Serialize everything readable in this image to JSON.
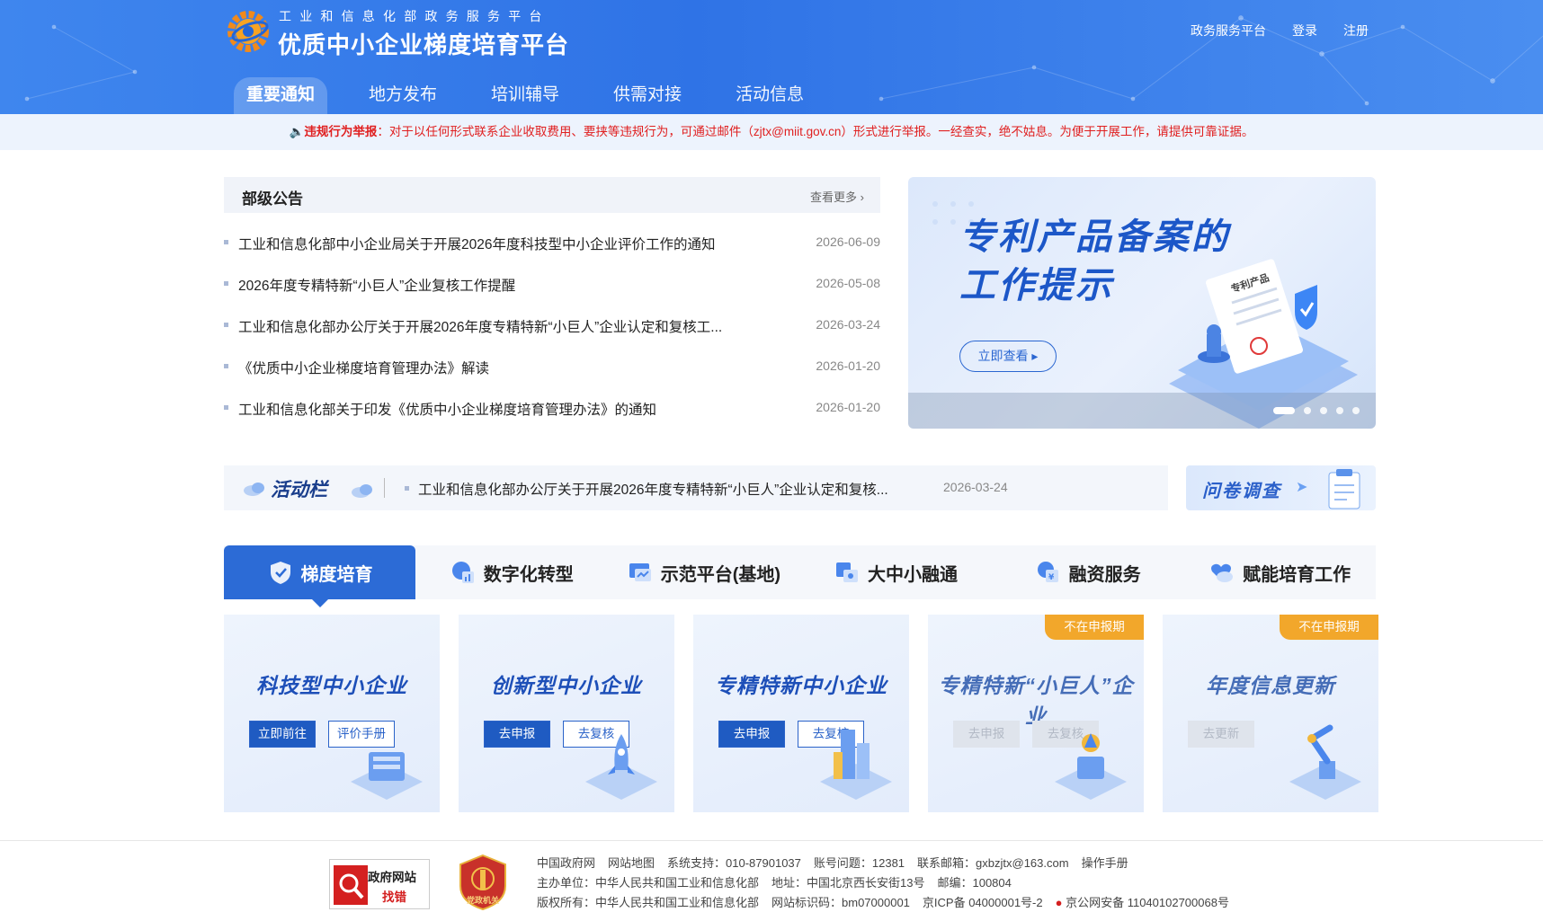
{
  "header": {
    "subtitle": "工业和信息化部政务服务平台",
    "title": "优质中小企业梯度培育平台",
    "links": [
      "政务服务平台",
      "登录",
      "注册"
    ],
    "nav": [
      "重要通知",
      "地方发布",
      "培训辅导",
      "供需对接",
      "活动信息"
    ]
  },
  "notice": {
    "label": "违规行为举报",
    "text": "：对于以任何形式联系企业收取费用、要挟等违规行为，可通过邮件（zjtx@miit.gov.cn）形式进行举报。一经查实，绝不姑息。为便于开展工作，请提供可靠证据。"
  },
  "announcements": {
    "title": "部级公告",
    "more": "查看更多",
    "items": [
      {
        "text": "工业和信息化部中小企业局关于开展2026年度科技型中小企业评价工作的通知",
        "date": "2026-06-09"
      },
      {
        "text": "2026年度专精特新“小巨人”企业复核工作提醒",
        "date": "2026-05-08"
      },
      {
        "text": "工业和信息化部办公厅关于开展2026年度专精特新“小巨人”企业认定和复核工...",
        "date": "2026-03-24"
      },
      {
        "text": "《优质中小企业梯度培育管理办法》解读",
        "date": "2026-01-20"
      },
      {
        "text": "工业和信息化部关于印发《优质中小企业梯度培育管理办法》的通知",
        "date": "2026-01-20"
      }
    ]
  },
  "banner": {
    "line1": "专利产品备案的",
    "line2": "工作提示",
    "button": "立即查看",
    "doc_label": "专利产品",
    "slide_count": 5,
    "active_slide": 1
  },
  "activity": {
    "label": "活动栏",
    "text": "工业和信息化部办公厅关于开展2026年度专精特新“小巨人”企业认定和复核...",
    "date": "2026-03-24",
    "survey": "问卷调查"
  },
  "service_tabs": [
    "梯度培育",
    "数字化转型",
    "示范平台(基地)",
    "大中小融通",
    "融资服务",
    "赋能培育工作"
  ],
  "cards": [
    {
      "title": "科技型中小企业",
      "buttons": [
        "立即前往",
        "评价手册"
      ],
      "badge": ""
    },
    {
      "title": "创新型中小企业",
      "buttons": [
        "去申报",
        "去复核"
      ],
      "badge": ""
    },
    {
      "title": "专精特新中小企业",
      "buttons": [
        "去申报",
        "去复核"
      ],
      "badge": ""
    },
    {
      "title": "专精特新“小巨人”企业",
      "buttons": [
        "去申报",
        "去复核"
      ],
      "badge": "不在申报期"
    },
    {
      "title": "年度信息更新",
      "buttons": [
        "去更新"
      ],
      "badge": "不在申报期"
    }
  ],
  "footer": {
    "badge_top": "政府网站",
    "badge_bottom": "找错",
    "seal_text": "党政机关",
    "line1": [
      "中国政府网",
      "网站地图",
      "系统支持：010-87901037",
      "账号问题：12381",
      "联系邮箱：gxbzjtx@163.com",
      "操作手册"
    ],
    "line2": [
      "主办单位：中华人民共和国工业和信息化部",
      "地址：中国北京西长安街13号",
      "邮编：100804"
    ],
    "line3": [
      "版权所有：中华人民共和国工业和信息化部",
      "网站标识码：bm07000001",
      "京ICP备 04000001号-2",
      "京公网安备 11040102700068号"
    ]
  },
  "colors": {
    "header_blue": "#3a7fec",
    "primary": "#1f5bc2",
    "notice_red": "#e02020",
    "badge_orange": "#f2a72b"
  }
}
